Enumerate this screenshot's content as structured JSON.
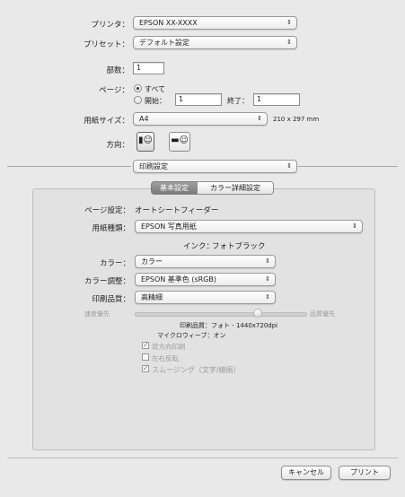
{
  "printer": {
    "label": "プリンタ：",
    "value": "EPSON XX-XXXX"
  },
  "preset": {
    "label": "プリセット：",
    "value": "デフォルト設定"
  },
  "copies": {
    "label": "部数：",
    "value": "1"
  },
  "pages": {
    "label": "ページ：",
    "all": "すべて",
    "from_label": "開始：",
    "from_value": "1",
    "to_label": "終了：",
    "to_value": "1"
  },
  "paper_size": {
    "label": "用紙サイズ：",
    "value": "A4",
    "dimensions": "210 x 297 mm"
  },
  "orientation": {
    "label": "方向：",
    "portrait_icon": "portrait-person-icon",
    "landscape_icon": "landscape-person-icon"
  },
  "section_menu": {
    "value": "印刷設定"
  },
  "tabs": [
    {
      "label": "基本設定"
    },
    {
      "label": "カラー詳細設定"
    }
  ],
  "page_setup": {
    "label": "ページ設定：",
    "value": "オートシートフィーダー"
  },
  "media_type": {
    "label": "用紙種類：",
    "value": "EPSON 写真用紙"
  },
  "ink": {
    "label": "インク：",
    "value": "フォトブラック"
  },
  "color": {
    "label": "カラー：",
    "value": "カラー"
  },
  "color_adjust": {
    "label": "カラー調整：",
    "value": "EPSON 基準色 (sRGB)"
  },
  "print_quality": {
    "label": "印刷品質：",
    "value": "高精細"
  },
  "slider": {
    "left": "速度優先",
    "right": "品質優先",
    "position": 0.72
  },
  "info": {
    "quality": "印刷品質：フォト - 1440x720dpi",
    "microweave": "マイクロウィーブ：オン"
  },
  "checkboxes": [
    {
      "label": "双方向印刷",
      "checked": true
    },
    {
      "label": "左右反転",
      "checked": false
    },
    {
      "label": "スムージング（文字/線画）",
      "checked": true
    }
  ],
  "buttons": {
    "cancel": "キャンセル",
    "print": "プリント"
  }
}
